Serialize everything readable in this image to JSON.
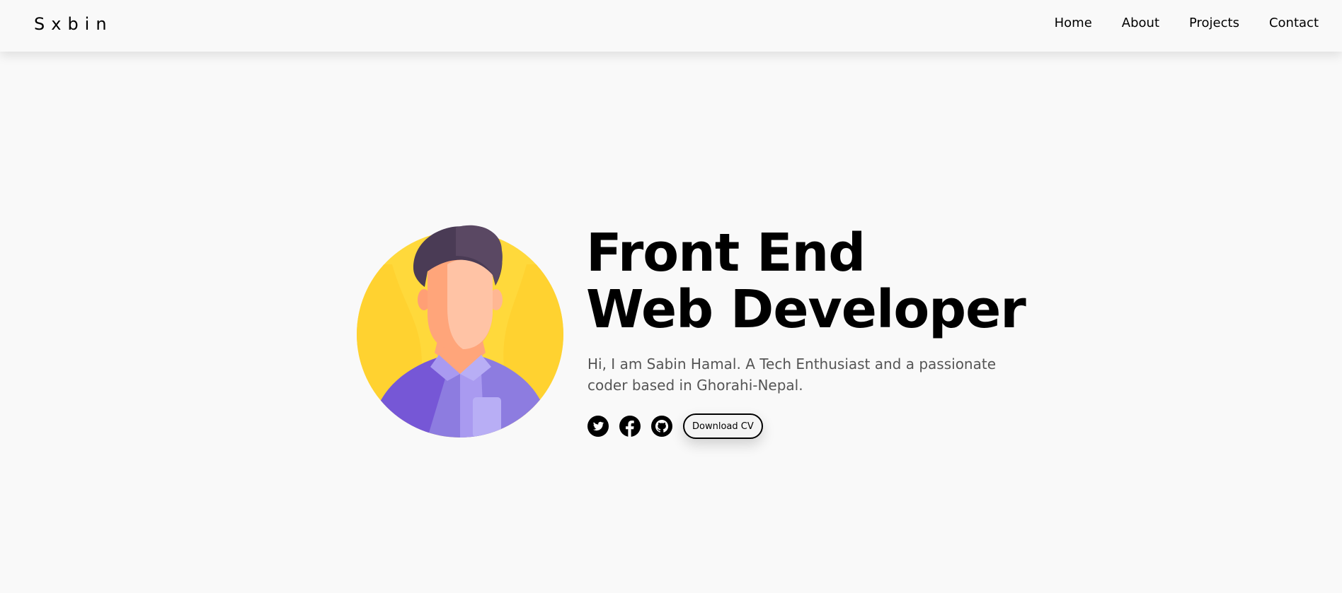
{
  "nav": {
    "logo": "Sxbin",
    "links": [
      {
        "label": "Home"
      },
      {
        "label": "About"
      },
      {
        "label": "Projects"
      },
      {
        "label": "Contact"
      }
    ]
  },
  "hero": {
    "title_line1": "Front End",
    "title_line2": "Web Developer",
    "description": "Hi, I am Sabin Hamal. A Tech Enthusiast and a passionate coder based in Ghorahi-Nepal.",
    "socials": [
      {
        "icon": "twitter-icon"
      },
      {
        "icon": "facebook-icon"
      },
      {
        "icon": "github-icon"
      }
    ],
    "cv_button": "Download CV"
  },
  "colors": {
    "background": "#f9f9f9",
    "avatar_bg": "#ffd93b",
    "shirt": "#8d7ce0",
    "hair": "#4a3b55",
    "skin": "#ffc0a0"
  }
}
